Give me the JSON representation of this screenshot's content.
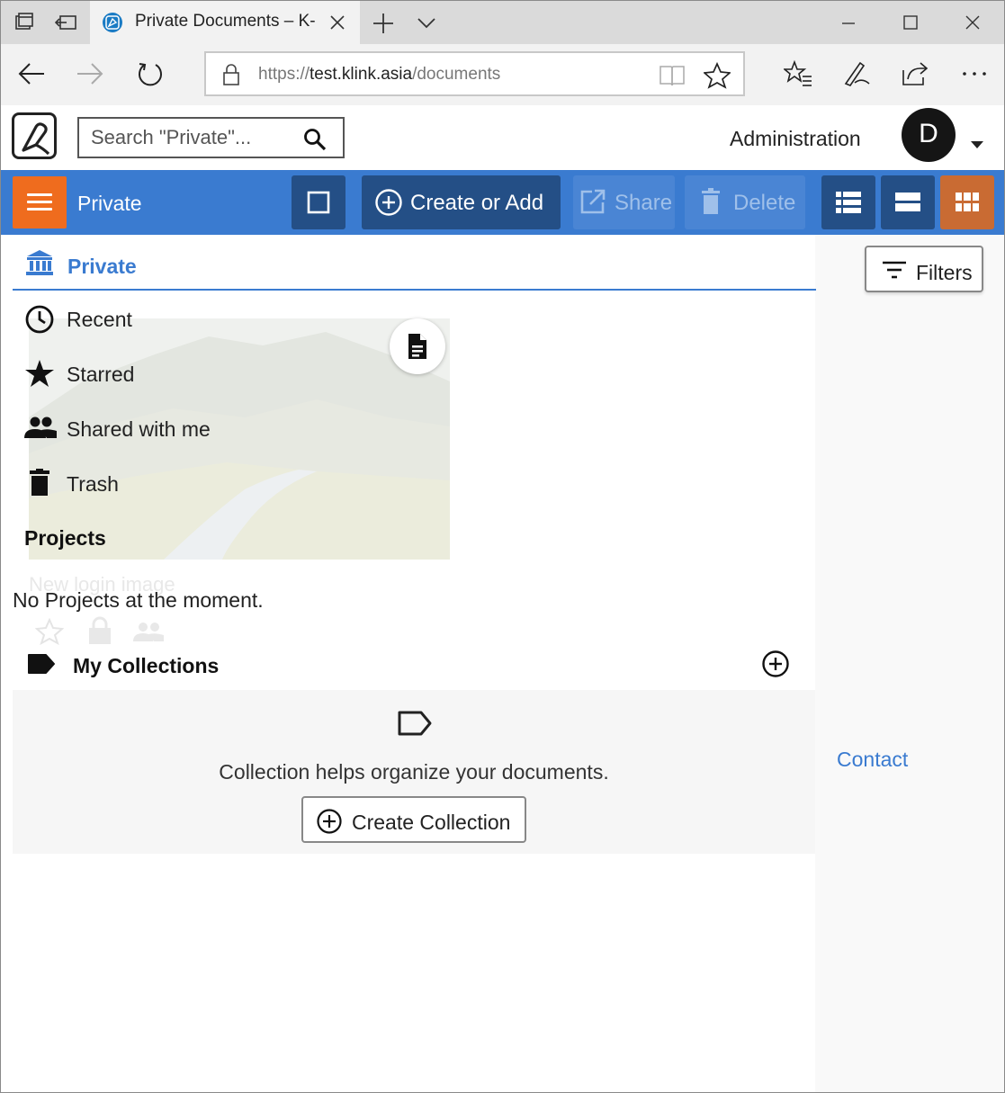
{
  "browser": {
    "tab_title": "Private Documents – K-",
    "url_scheme": "https://",
    "url_host": "test.klink.asia",
    "url_path": "/documents"
  },
  "header": {
    "search_placeholder": "Search \"Private\"...",
    "administration_label": "Administration",
    "avatar_initial": "D"
  },
  "toolbar": {
    "context_title": "Private",
    "create_label": "Create or Add",
    "share_label": "Share",
    "delete_label": "Delete",
    "accent_color": "#3a7bd0",
    "menu_color": "#ef6c1e"
  },
  "nav": {
    "active_label": "Private",
    "items": [
      {
        "label": "Recent",
        "icon": "clock-icon"
      },
      {
        "label": "Starred",
        "icon": "star-icon"
      },
      {
        "label": "Shared with me",
        "icon": "people-icon"
      },
      {
        "label": "Trash",
        "icon": "trash-icon"
      }
    ],
    "projects_title": "Projects",
    "projects_empty": "No Projects at the moment.",
    "collections_title": "My Collections"
  },
  "collections": {
    "empty_message": "Collection helps organize your documents.",
    "create_label": "Create Collection"
  },
  "document": {
    "title": "New login image"
  },
  "side": {
    "filters_label": "Filters",
    "contact_label": "Contact"
  }
}
